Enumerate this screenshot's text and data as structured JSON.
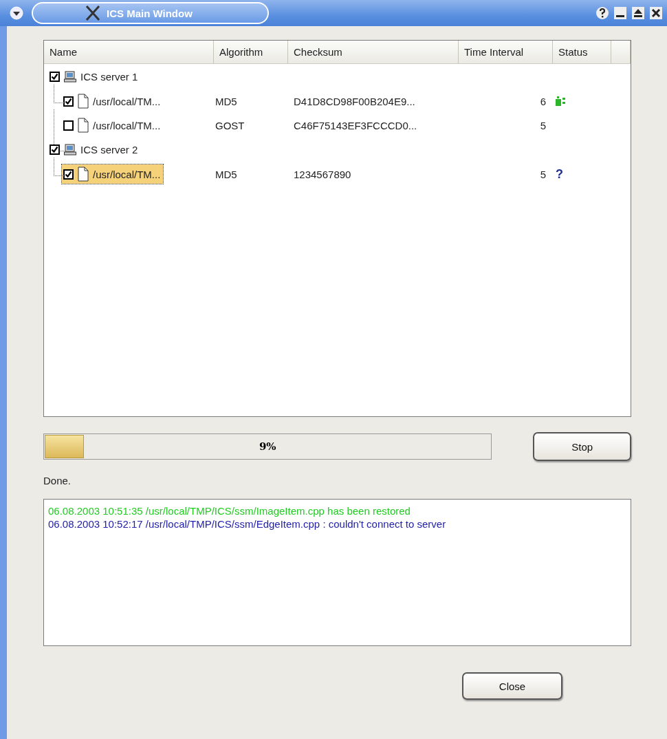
{
  "window": {
    "title": "ICS Main Window"
  },
  "table": {
    "columns": [
      "Name",
      "Algorithm",
      "Checksum",
      "Time Interval",
      "Status"
    ],
    "rows": [
      {
        "name": "ICS server 1",
        "checked": true,
        "children": [
          {
            "name": "/usr/local/TM...",
            "checked": true,
            "selected": false,
            "algorithm": "MD5",
            "checksum": "D41D8CD98F00B204E9...",
            "interval": "6",
            "status": {
              "kind": "ok"
            }
          },
          {
            "name": "/usr/local/TM...",
            "checked": false,
            "selected": false,
            "algorithm": "GOST",
            "checksum": "C46F75143EF3FCCCD0...",
            "interval": "5",
            "status": {
              "kind": "none"
            }
          }
        ]
      },
      {
        "name": "ICS server 2",
        "checked": true,
        "children": [
          {
            "name": "/usr/local/TM...",
            "checked": true,
            "selected": true,
            "algorithm": "MD5",
            "checksum": "1234567890",
            "interval": "5",
            "status": {
              "kind": "text",
              "text": "?"
            }
          }
        ]
      }
    ]
  },
  "progress": {
    "level": 0.09,
    "label": "9%"
  },
  "stop_button": "Stop",
  "status_text": "Done.",
  "log": [
    {
      "text": "06.08.2003  10:51:35  /usr/local/TMP/ICS/ssm/ImageItem.cpp has been restored",
      "color": "#22cc22"
    },
    {
      "text": "06.08.2003  10:52:17  /usr/local/TMP/ICS/ssm/EdgeItem.cpp : couldn't connect to server",
      "color": "#2222aa"
    }
  ],
  "close_button": "Close"
}
